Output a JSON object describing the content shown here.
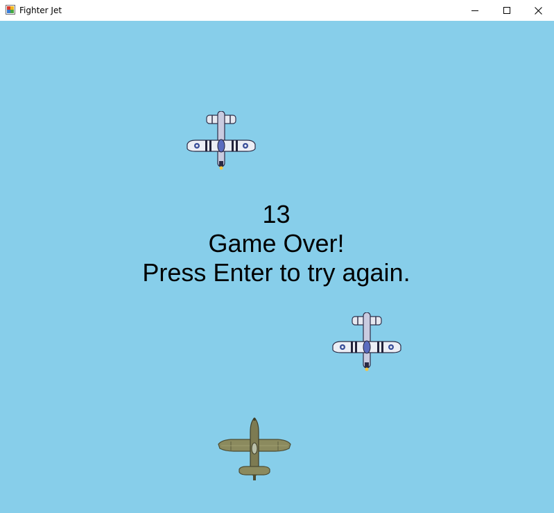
{
  "window": {
    "title": "Fighter Jet"
  },
  "game": {
    "score": "13",
    "game_over": "Game Over!",
    "prompt": "Press Enter to try again.",
    "background_color": "#87ceea"
  },
  "sprites": {
    "enemy_plane_icon": "p51-mustang-enemy-icon",
    "player_plane_icon": "fighter-plane-player-icon"
  }
}
